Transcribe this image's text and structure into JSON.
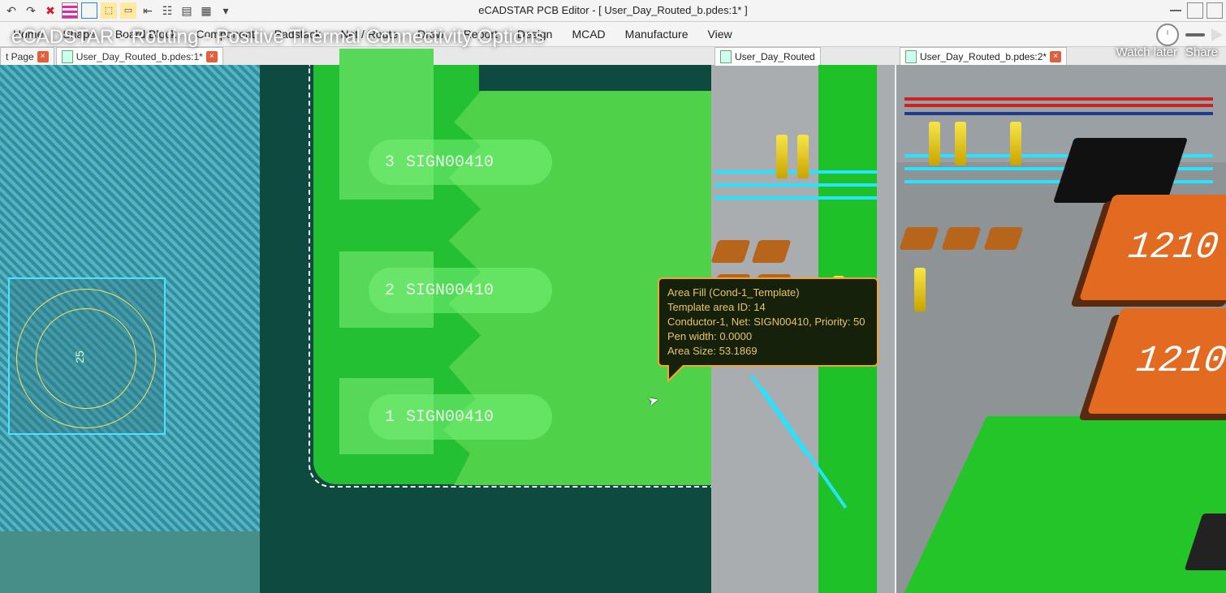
{
  "window": {
    "title": "eCADSTAR PCB Editor - [ User_Day_Routed_b.pdes:1* ]"
  },
  "video": {
    "title": "eCADSTAR - Routing - Positive Thermal Connectivity Options",
    "watch_later": "Watch later",
    "share": "Share"
  },
  "menus": {
    "items": [
      "Home",
      "Shape",
      "Board Block",
      "Component",
      "Padstack",
      "Net / Route",
      "Draw",
      "Report",
      "Design",
      "MCAD",
      "Manufacture",
      "View"
    ]
  },
  "tabs": {
    "items": [
      {
        "label": "t Page",
        "closable": true
      },
      {
        "label": "User_Day_Routed_b.pdes:1*",
        "closable": true,
        "active": true
      },
      {
        "label": "User_Day_Routed",
        "closable": false,
        "pane": 2
      },
      {
        "label": "User_Day_Routed_b.pdes:2*",
        "closable": true,
        "pane": 3
      }
    ]
  },
  "via": {
    "label": "25"
  },
  "nets": [
    {
      "index": "3",
      "name": "SIGN00410"
    },
    {
      "index": "2",
      "name": "SIGN00410"
    },
    {
      "index": "1",
      "name": "SIGN00410"
    }
  ],
  "tooltip": {
    "l1": "Area Fill (Cond-1_Template)",
    "l2": "Template area ID: 14",
    "l3": "Conductor-1, Net: SIGN00410, Priority: 50",
    "l4": "Pen width: 0.0000",
    "l5": "Area Size: 53.1869"
  },
  "components3d": {
    "cap_label": "1210"
  }
}
